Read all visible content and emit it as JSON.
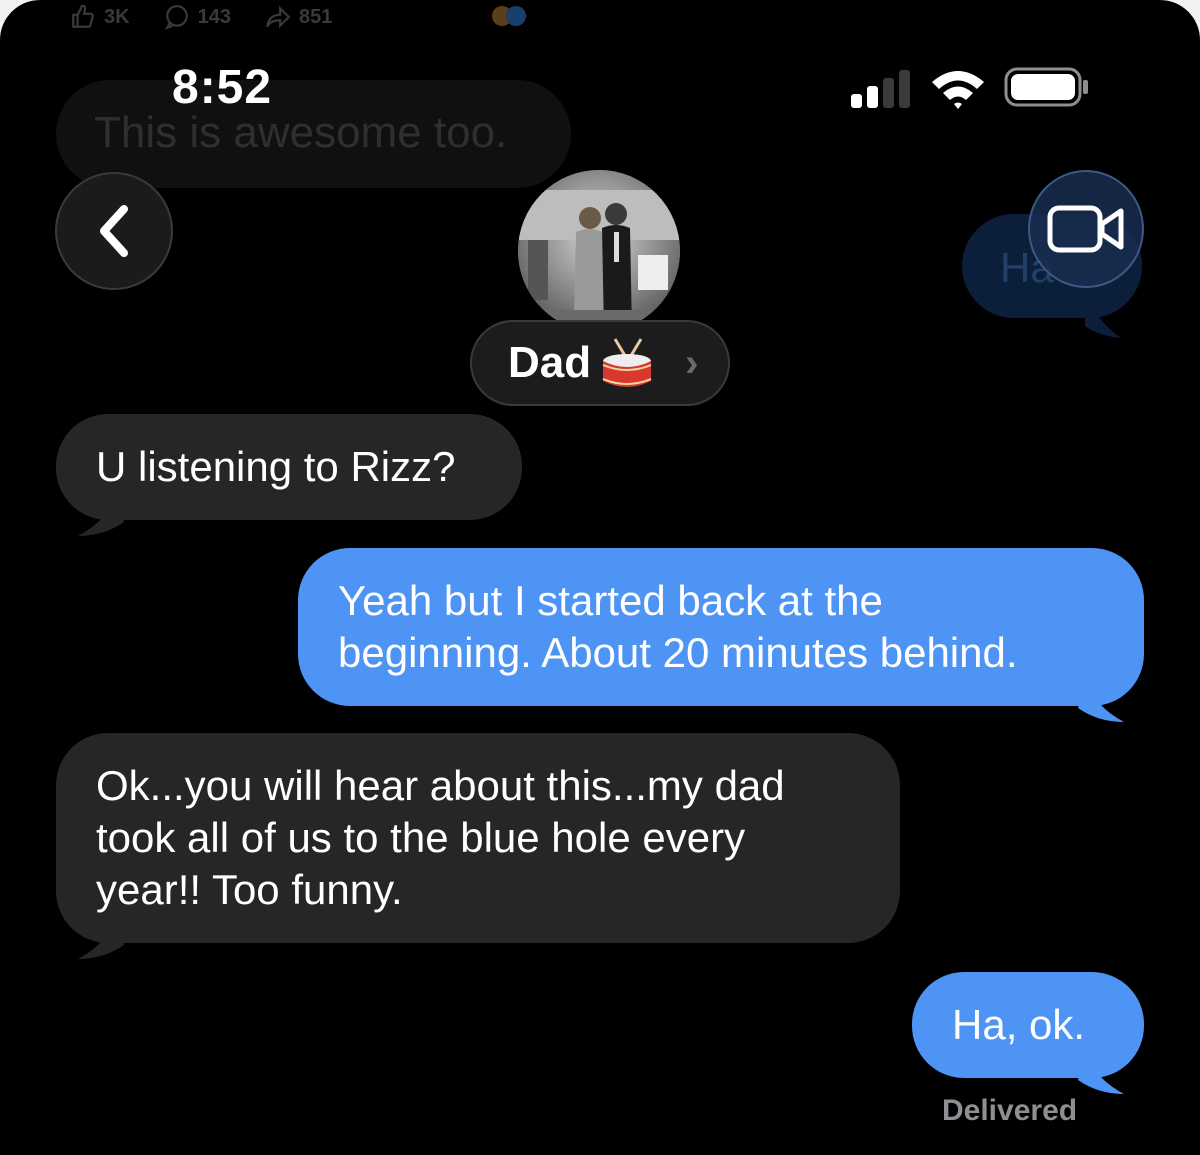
{
  "overlay": {
    "likes": "3K",
    "comments": "143",
    "shares": "851",
    "ghost_left_text": "This is awesome too.",
    "ghost_right_text": "Ha"
  },
  "status_bar": {
    "time": "8:52"
  },
  "header": {
    "contact_name": "Dad",
    "contact_emoji_icon": "drum-icon",
    "back_icon": "chevron-left-icon",
    "video_icon": "video-camera-icon"
  },
  "messages": [
    {
      "direction": "incoming",
      "lines": [
        "U listening to Rizz?"
      ]
    },
    {
      "direction": "outgoing",
      "lines": [
        "Yeah but I started back at the",
        "beginning. About 20 minutes behind."
      ]
    },
    {
      "direction": "incoming",
      "lines": [
        "Ok...you will hear about this...my dad",
        "took all of us to the blue hole every",
        "year!!  Too funny."
      ]
    },
    {
      "direction": "outgoing",
      "lines": [
        "Ha, ok."
      ]
    }
  ],
  "receipt": "Delivered",
  "colors": {
    "incoming_bubble": "#262628",
    "outgoing_bubble": "#4e94f5",
    "background": "#000000"
  }
}
